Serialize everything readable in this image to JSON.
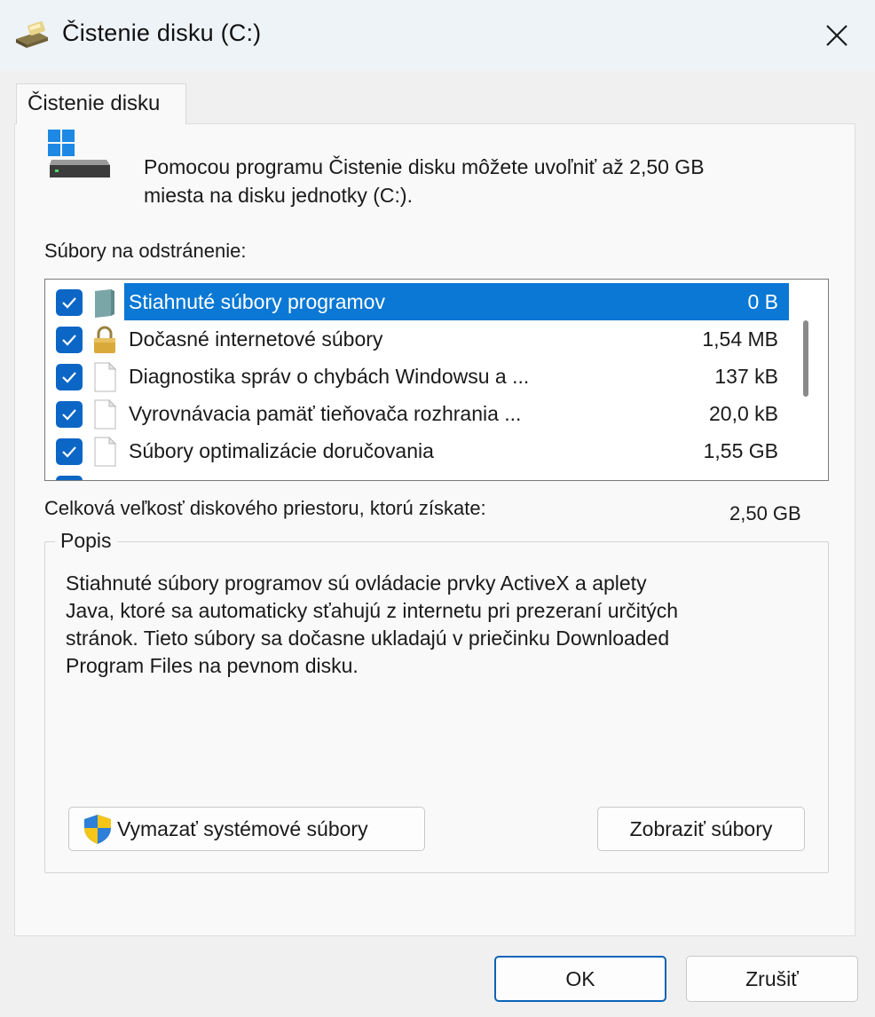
{
  "window": {
    "title": "Čistenie disku  (C:)"
  },
  "tab": {
    "label": "Čistenie disku"
  },
  "intro": {
    "line1": "Pomocou programu Čistenie disku môžete uvoľniť až 2,50 GB",
    "line2": "miesta na disku jednotky  (C:)."
  },
  "files": {
    "label": "Súbory na odstránenie:",
    "items": [
      {
        "name": "Stiahnuté súbory programov",
        "size": "0 B",
        "checked": true,
        "icon": "folder-icon",
        "selected": true
      },
      {
        "name": "Dočasné internetové súbory",
        "size": "1,54 MB",
        "checked": true,
        "icon": "lock-icon",
        "selected": false
      },
      {
        "name": "Diagnostika správ o chybách Windowsu a ...",
        "size": "137 kB",
        "checked": true,
        "icon": "file-icon",
        "selected": false
      },
      {
        "name": "Vyrovnávacia pamäť tieňovača rozhrania ...",
        "size": "20,0 kB",
        "checked": true,
        "icon": "file-icon",
        "selected": false
      },
      {
        "name": "Súbory optimalizácie doručovania",
        "size": "1,55 GB",
        "checked": true,
        "icon": "file-icon",
        "selected": false
      }
    ]
  },
  "total": {
    "label": "Celková veľkosť diskového priestoru, ktorú získate:",
    "value": "2,50 GB"
  },
  "description": {
    "legend": "Popis",
    "lines": [
      "Stiahnuté súbory programov sú ovládacie prvky ActiveX a aplety",
      "Java, ktoré sa automaticky sťahujú z internetu pri prezeraní určitých",
      "stránok. Tieto súbory sa dočasne ukladajú v priečinku Downloaded",
      "Program Files na pevnom disku."
    ]
  },
  "buttons": {
    "clean_system": "Vymazať systémové súbory",
    "view_files": "Zobraziť súbory",
    "ok": "OK",
    "cancel": "Zrušiť"
  },
  "colors": {
    "accent": "#0a78d4",
    "checkbox": "#0b66c6"
  }
}
